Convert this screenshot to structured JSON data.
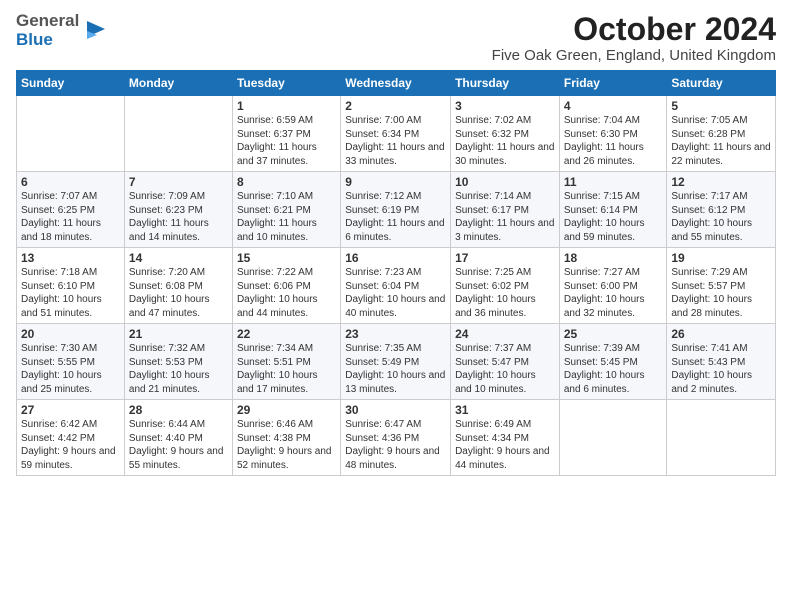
{
  "header": {
    "logo_general": "General",
    "logo_blue": "Blue",
    "month": "October 2024",
    "location": "Five Oak Green, England, United Kingdom"
  },
  "weekdays": [
    "Sunday",
    "Monday",
    "Tuesday",
    "Wednesday",
    "Thursday",
    "Friday",
    "Saturday"
  ],
  "weeks": [
    [
      {
        "day": "",
        "info": ""
      },
      {
        "day": "",
        "info": ""
      },
      {
        "day": "1",
        "info": "Sunrise: 6:59 AM\nSunset: 6:37 PM\nDaylight: 11 hours and 37 minutes."
      },
      {
        "day": "2",
        "info": "Sunrise: 7:00 AM\nSunset: 6:34 PM\nDaylight: 11 hours and 33 minutes."
      },
      {
        "day": "3",
        "info": "Sunrise: 7:02 AM\nSunset: 6:32 PM\nDaylight: 11 hours and 30 minutes."
      },
      {
        "day": "4",
        "info": "Sunrise: 7:04 AM\nSunset: 6:30 PM\nDaylight: 11 hours and 26 minutes."
      },
      {
        "day": "5",
        "info": "Sunrise: 7:05 AM\nSunset: 6:28 PM\nDaylight: 11 hours and 22 minutes."
      }
    ],
    [
      {
        "day": "6",
        "info": "Sunrise: 7:07 AM\nSunset: 6:25 PM\nDaylight: 11 hours and 18 minutes."
      },
      {
        "day": "7",
        "info": "Sunrise: 7:09 AM\nSunset: 6:23 PM\nDaylight: 11 hours and 14 minutes."
      },
      {
        "day": "8",
        "info": "Sunrise: 7:10 AM\nSunset: 6:21 PM\nDaylight: 11 hours and 10 minutes."
      },
      {
        "day": "9",
        "info": "Sunrise: 7:12 AM\nSunset: 6:19 PM\nDaylight: 11 hours and 6 minutes."
      },
      {
        "day": "10",
        "info": "Sunrise: 7:14 AM\nSunset: 6:17 PM\nDaylight: 11 hours and 3 minutes."
      },
      {
        "day": "11",
        "info": "Sunrise: 7:15 AM\nSunset: 6:14 PM\nDaylight: 10 hours and 59 minutes."
      },
      {
        "day": "12",
        "info": "Sunrise: 7:17 AM\nSunset: 6:12 PM\nDaylight: 10 hours and 55 minutes."
      }
    ],
    [
      {
        "day": "13",
        "info": "Sunrise: 7:18 AM\nSunset: 6:10 PM\nDaylight: 10 hours and 51 minutes."
      },
      {
        "day": "14",
        "info": "Sunrise: 7:20 AM\nSunset: 6:08 PM\nDaylight: 10 hours and 47 minutes."
      },
      {
        "day": "15",
        "info": "Sunrise: 7:22 AM\nSunset: 6:06 PM\nDaylight: 10 hours and 44 minutes."
      },
      {
        "day": "16",
        "info": "Sunrise: 7:23 AM\nSunset: 6:04 PM\nDaylight: 10 hours and 40 minutes."
      },
      {
        "day": "17",
        "info": "Sunrise: 7:25 AM\nSunset: 6:02 PM\nDaylight: 10 hours and 36 minutes."
      },
      {
        "day": "18",
        "info": "Sunrise: 7:27 AM\nSunset: 6:00 PM\nDaylight: 10 hours and 32 minutes."
      },
      {
        "day": "19",
        "info": "Sunrise: 7:29 AM\nSunset: 5:57 PM\nDaylight: 10 hours and 28 minutes."
      }
    ],
    [
      {
        "day": "20",
        "info": "Sunrise: 7:30 AM\nSunset: 5:55 PM\nDaylight: 10 hours and 25 minutes."
      },
      {
        "day": "21",
        "info": "Sunrise: 7:32 AM\nSunset: 5:53 PM\nDaylight: 10 hours and 21 minutes."
      },
      {
        "day": "22",
        "info": "Sunrise: 7:34 AM\nSunset: 5:51 PM\nDaylight: 10 hours and 17 minutes."
      },
      {
        "day": "23",
        "info": "Sunrise: 7:35 AM\nSunset: 5:49 PM\nDaylight: 10 hours and 13 minutes."
      },
      {
        "day": "24",
        "info": "Sunrise: 7:37 AM\nSunset: 5:47 PM\nDaylight: 10 hours and 10 minutes."
      },
      {
        "day": "25",
        "info": "Sunrise: 7:39 AM\nSunset: 5:45 PM\nDaylight: 10 hours and 6 minutes."
      },
      {
        "day": "26",
        "info": "Sunrise: 7:41 AM\nSunset: 5:43 PM\nDaylight: 10 hours and 2 minutes."
      }
    ],
    [
      {
        "day": "27",
        "info": "Sunrise: 6:42 AM\nSunset: 4:42 PM\nDaylight: 9 hours and 59 minutes."
      },
      {
        "day": "28",
        "info": "Sunrise: 6:44 AM\nSunset: 4:40 PM\nDaylight: 9 hours and 55 minutes."
      },
      {
        "day": "29",
        "info": "Sunrise: 6:46 AM\nSunset: 4:38 PM\nDaylight: 9 hours and 52 minutes."
      },
      {
        "day": "30",
        "info": "Sunrise: 6:47 AM\nSunset: 4:36 PM\nDaylight: 9 hours and 48 minutes."
      },
      {
        "day": "31",
        "info": "Sunrise: 6:49 AM\nSunset: 4:34 PM\nDaylight: 9 hours and 44 minutes."
      },
      {
        "day": "",
        "info": ""
      },
      {
        "day": "",
        "info": ""
      }
    ]
  ]
}
